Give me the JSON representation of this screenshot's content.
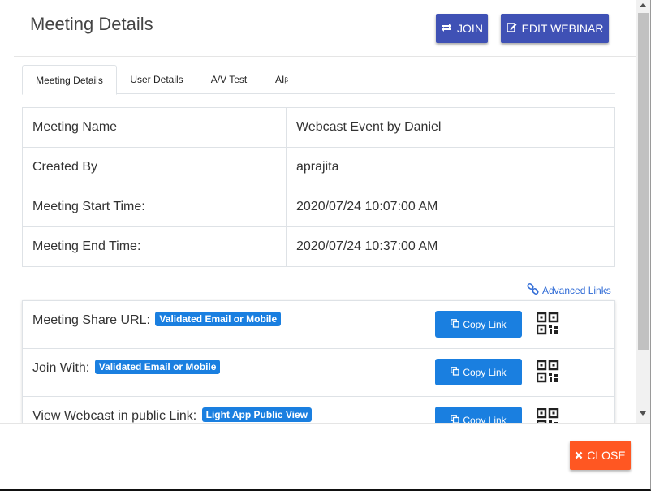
{
  "dialog": {
    "title": "Meeting Details",
    "join_label": "JOIN",
    "edit_label": "EDIT WEBINAR",
    "close_label": "CLOSE"
  },
  "tabs": [
    {
      "label": "Meeting Details",
      "active": true
    },
    {
      "label": "User Details",
      "active": false
    },
    {
      "label": "A/V Test",
      "active": false
    },
    {
      "label": "AI",
      "sup": "β",
      "active": false
    }
  ],
  "details": [
    {
      "key": "Meeting Name",
      "value": "Webcast Event by Daniel"
    },
    {
      "key": "Created By",
      "value": "aprajita"
    },
    {
      "key": "Meeting Start Time:",
      "value": "2020/07/24 10:07:00 AM"
    },
    {
      "key": "Meeting End Time:",
      "value": "2020/07/24 10:37:00 AM"
    }
  ],
  "advanced_links_label": "Advanced Links",
  "links": [
    {
      "label": "Meeting Share URL:",
      "badge": "Validated Email or Mobile",
      "copy_label": "Copy Link"
    },
    {
      "label": "Join With:",
      "badge": "Validated Email or Mobile",
      "copy_label": "Copy Link"
    },
    {
      "label": "View Webcast in public Link:",
      "badge": "Light App Public View",
      "copy_label": "Copy Link"
    }
  ],
  "colors": {
    "primary": "#3f51b5",
    "link_button": "#1a7fe0",
    "close_button": "#ff5722",
    "link_text": "#2f6bd6"
  },
  "icons": {
    "join": "refresh-icon",
    "edit": "edit-icon",
    "advanced": "link-icon",
    "copy": "copy-icon",
    "qr": "qr-code-icon",
    "close": "close-icon"
  }
}
